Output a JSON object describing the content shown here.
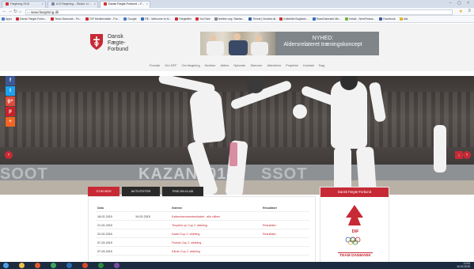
{
  "browser": {
    "tabs": [
      {
        "label": "Fægtning 2015"
      },
      {
        "label": "kl 8 Fægtning – Studio: U..."
      },
      {
        "label": "Dansk Fægte-Forbund – F..."
      }
    ],
    "url": "www.faegtning.dk",
    "bookmarks": [
      {
        "label": "Apps",
        "color": "#4a7bd0"
      },
      {
        "label": "Dansk Fægte-Forbu...",
        "color": "#c72a35"
      },
      {
        "label": "Team Danmark - Pu...",
        "color": "#c72a35"
      },
      {
        "label": "DIF Medlemsliste - For...",
        "color": "#c72a35"
      },
      {
        "label": "Google",
        "color": "#4a7bd0"
      },
      {
        "label": "FIE - Welcome to th...",
        "color": "#2f6cb8"
      },
      {
        "label": "Fægtefilm",
        "color": "#c72a35"
      },
      {
        "label": "YouTube",
        "color": "#d62a2a"
      },
      {
        "label": "fechten.org: Startse...",
        "color": "#888888"
      },
      {
        "label": "Threat | Nordea dk",
        "color": "#2f5fa3"
      },
      {
        "label": "Kollektivt Bogførin...",
        "color": "#cc3333"
      },
      {
        "label": "TeamDanmark Me...",
        "color": "#2f6cb8"
      },
      {
        "label": "Voksit - NemFinans...",
        "color": "#7bb03d"
      },
      {
        "label": "Facebook",
        "color": "#3b5998"
      },
      {
        "label": "ubk",
        "color": "#e3b52a"
      }
    ]
  },
  "site": {
    "logo_lines": [
      "Dansk",
      "Fægte-",
      "Forbund"
    ],
    "banner_title_1": "NYHED:",
    "banner_title_2": "Aldersrelateret træningskoncept",
    "nav": [
      "Forside",
      "Om DFF",
      "Om fægtning",
      "Klubber",
      "Aktive",
      "Nyheder",
      "Stævner",
      "Aktiviteter",
      "Projekter",
      "Kontakt",
      "Søg"
    ],
    "hero_ad_left": "SOOT",
    "hero_ad_mid": "KAZAN2014",
    "hero_ad_right": "SSOT",
    "social": [
      {
        "label": "f",
        "color": "#3b5998"
      },
      {
        "label": "t",
        "color": "#1da1f2"
      },
      {
        "label": "g+",
        "color": "#dd4b39"
      },
      {
        "label": "p",
        "color": "#cb2027"
      },
      {
        "label": "+",
        "color": "#f26522"
      }
    ]
  },
  "content_tabs": [
    "STÆVNER",
    "AKTIVITETER",
    "FIND EN KLUB"
  ],
  "events_table": {
    "headers": [
      "Dato",
      "",
      "Stævne",
      "Resultater"
    ],
    "rows": [
      {
        "start": "18-02-2015",
        "end": "19-02-2015",
        "name": "Københavnmesterskabet - alle våben",
        "result": ""
      },
      {
        "start": "21-02-2015",
        "end": "",
        "name": "Tenybird op Cup 2. afdeling",
        "result": "Resultater"
      },
      {
        "start": "22-02-2015",
        "end": "",
        "name": "Kadet Cup 2. afdeling",
        "result": "Resultater"
      },
      {
        "start": "07-03-2015",
        "end": "",
        "name": "Florbat Cup 2. afdeling",
        "result": ""
      },
      {
        "start": "07-03-2015",
        "end": "",
        "name": "Kårde Cup 2. afdeling",
        "result": ""
      }
    ]
  },
  "sidebar_panel": {
    "title": "Dansk Fægte-Forbund",
    "dif_text": "DIF",
    "team_text": "TEAM DANMARK"
  },
  "taskbar": {
    "time": "12:04",
    "date": "16-02-2015"
  }
}
